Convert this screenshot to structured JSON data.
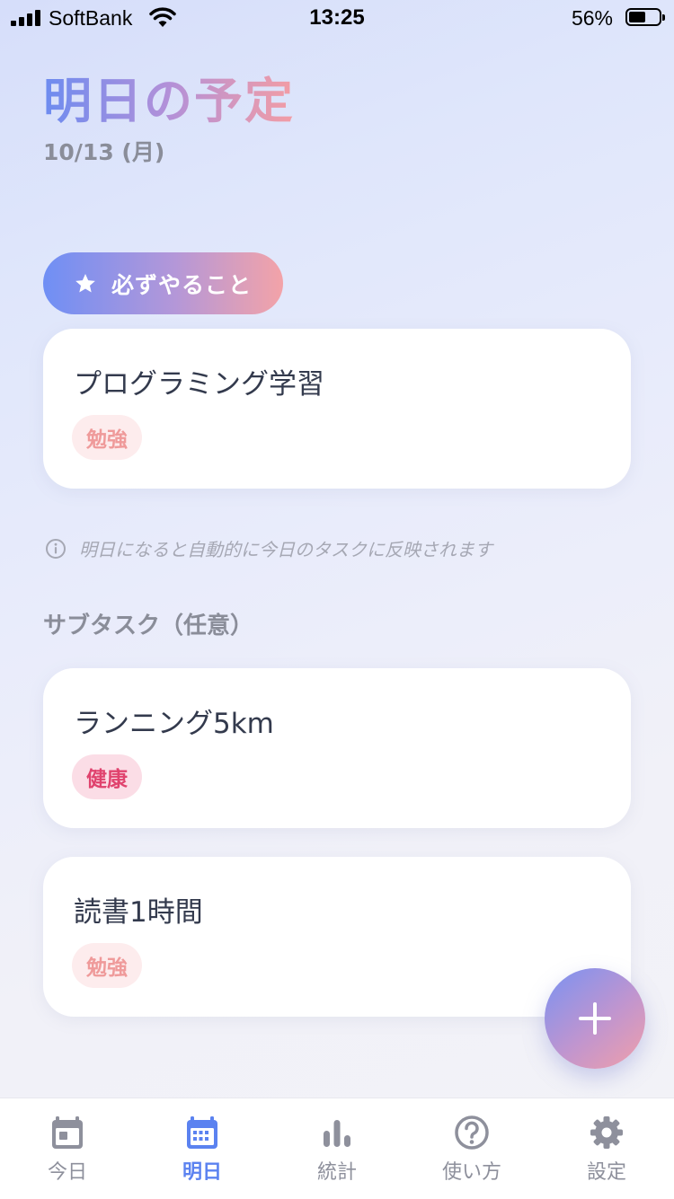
{
  "status_bar": {
    "carrier": "SoftBank",
    "time": "13:25",
    "battery_percent": "56%",
    "battery_level": 0.56
  },
  "header": {
    "title": "明日の予定",
    "date": "10/13 (月)"
  },
  "must_do": {
    "label": "必ずやること",
    "task": {
      "title": "プログラミング学習",
      "tag": "勉強"
    }
  },
  "info_note": "明日になると自動的に今日のタスクに反映されます",
  "subtasks": {
    "section_label": "サブタスク（任意）",
    "items": [
      {
        "title": "ランニング5km",
        "tag": "健康"
      },
      {
        "title": "読書1時間",
        "tag": "勉強"
      }
    ]
  },
  "colors": {
    "accent_blue": "#5b82f0",
    "accent_pink": "#f39da4",
    "tag_study_text": "#ef9a9a",
    "tag_health_text": "#e0436e"
  },
  "tab_bar": {
    "items": [
      {
        "label": "今日",
        "icon": "calendar-today-icon"
      },
      {
        "label": "明日",
        "icon": "calendar-icon"
      },
      {
        "label": "統計",
        "icon": "bar-chart-icon"
      },
      {
        "label": "使い方",
        "icon": "help-circle-icon"
      },
      {
        "label": "設定",
        "icon": "gear-icon"
      }
    ],
    "active_index": 1
  }
}
